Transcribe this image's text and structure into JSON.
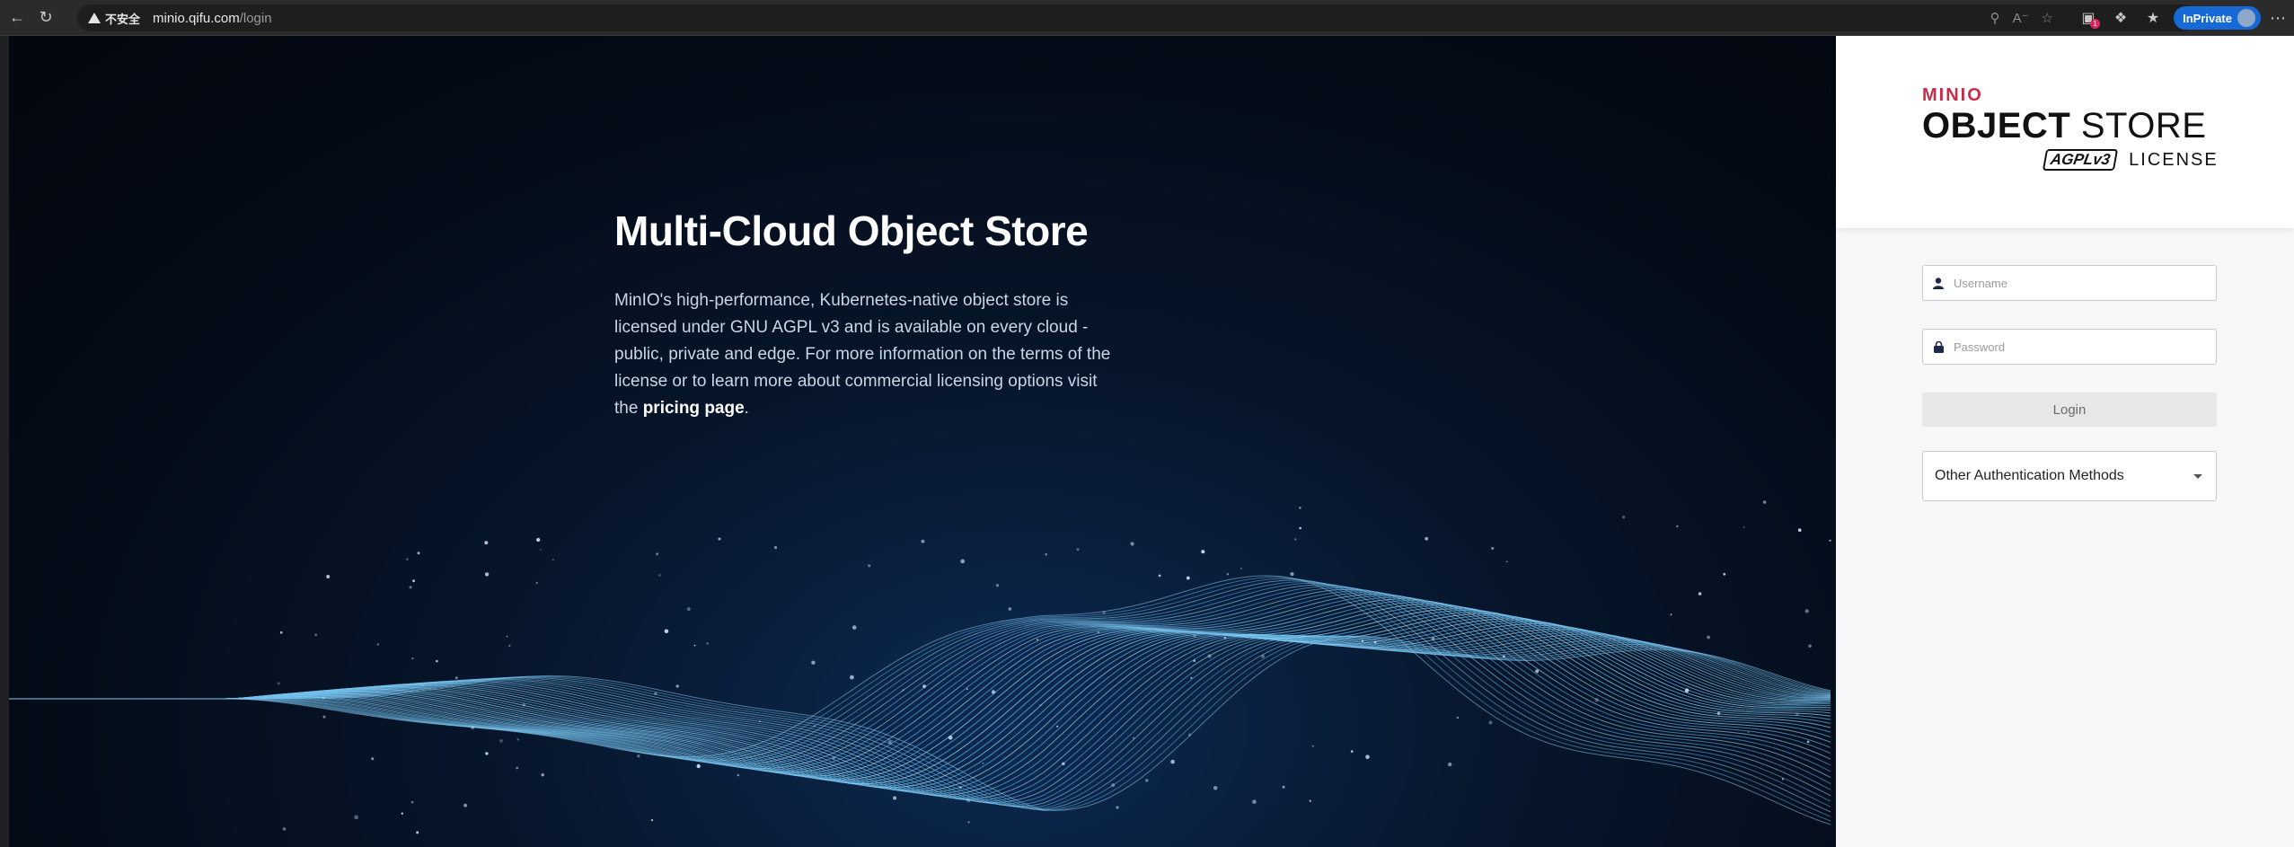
{
  "browser": {
    "security_label": "不安全",
    "url_host": "minio.qifu.com",
    "url_path": "/login",
    "inprivate_label": "InPrivate",
    "extension_badge": "1"
  },
  "hero": {
    "headline": "Multi-Cloud Object Store",
    "description_text": "MinIO's high-performance, Kubernetes-native object store is licensed under GNU AGPL v3 and is available on every cloud - public, private and edge. For more information on the terms of the license or to learn more about commercial licensing options visit the ",
    "pricing_link": "pricing page",
    "description_end": "."
  },
  "logo": {
    "brand": "MINIO",
    "product_bold": "OBJECT",
    "product_light": " STORE",
    "agpl": "AGPLv3",
    "license": "LICENSE"
  },
  "form": {
    "username_placeholder": "Username",
    "password_placeholder": "Password",
    "login_label": "Login",
    "other_auth_label": "Other Authentication Methods"
  },
  "colors": {
    "brand_red": "#c72c48",
    "hero_bg": "#040b17",
    "wave_blue": "#5fb6e8",
    "panel_bg": "#f6f7f8"
  }
}
